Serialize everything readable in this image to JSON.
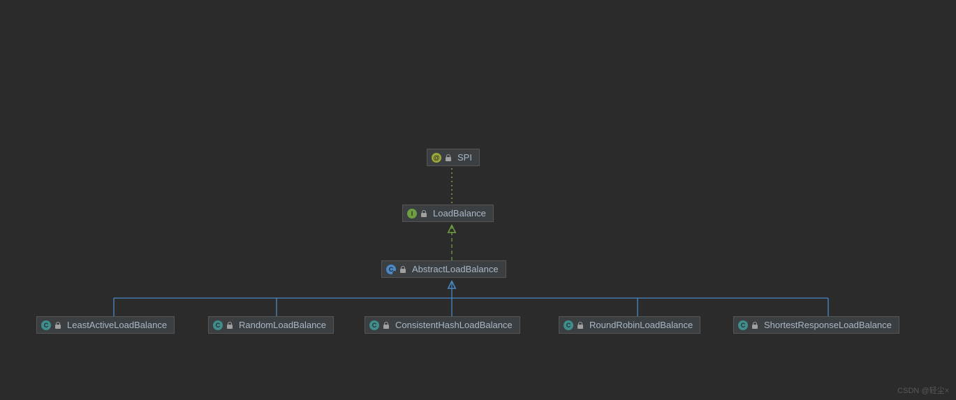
{
  "diagram": {
    "spi": {
      "name": "SPI",
      "type": "annotation"
    },
    "loadbalance": {
      "name": "LoadBalance",
      "type": "interface"
    },
    "abstract": {
      "name": "AbstractLoadBalance",
      "type": "abstract-class"
    },
    "impls": [
      {
        "name": "LeastActiveLoadBalance",
        "type": "class"
      },
      {
        "name": "RandomLoadBalance",
        "type": "class"
      },
      {
        "name": "ConsistentHashLoadBalance",
        "type": "class"
      },
      {
        "name": "RoundRobinLoadBalance",
        "type": "class"
      },
      {
        "name": "ShortestResponseLoadBalance",
        "type": "class"
      }
    ]
  },
  "watermark": "CSDN @轻尘×",
  "icons": {
    "annotation_letter": "@",
    "interface_letter": "I",
    "abstract_letter": "C",
    "class_letter": "C"
  }
}
